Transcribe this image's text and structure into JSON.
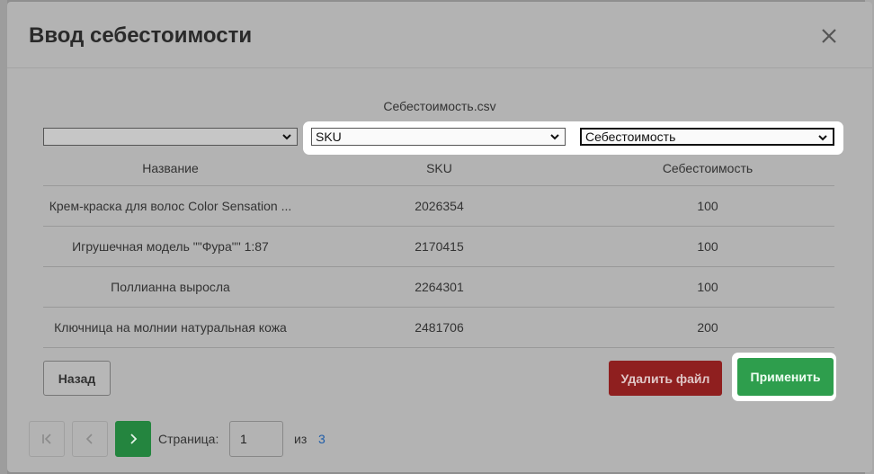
{
  "modal": {
    "title": "Ввод себестоимости",
    "file_name": "Себестоимость.csv"
  },
  "mapping": {
    "column1": "",
    "column2": "SKU",
    "column3": "Себестоимость"
  },
  "table": {
    "headers": [
      "Название",
      "SKU",
      "Себестоимость"
    ],
    "rows": [
      [
        "Крем-краска для волос Color Sensation ...",
        "2026354",
        "100"
      ],
      [
        "Игрушечная модель \"\"Фура\"\" 1:87",
        "2170415",
        "100"
      ],
      [
        "Поллианна выросла",
        "2264301",
        "100"
      ],
      [
        "Ключница на молнии натуральная кожа",
        "2481706",
        "200"
      ]
    ]
  },
  "buttons": {
    "back": "Назад",
    "delete": "Удалить файл",
    "apply": "Применить"
  },
  "pagination": {
    "label": "Страница:",
    "current": "1",
    "of": "из",
    "total": "3"
  },
  "icons": {
    "close": "close-icon",
    "first": "first-page-icon",
    "prev": "chevron-left-icon",
    "next": "chevron-right-icon",
    "dropdown": "chevron-down-icon"
  }
}
